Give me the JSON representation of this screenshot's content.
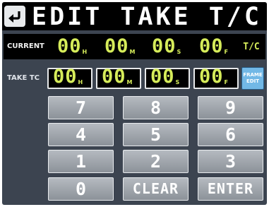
{
  "header": {
    "title": "EDIT TAKE T/C",
    "back_icon": "return-arrow-icon"
  },
  "current": {
    "label": "CURRENT",
    "fields": [
      {
        "value": "00",
        "unit": "H"
      },
      {
        "value": "00",
        "unit": "M"
      },
      {
        "value": "00",
        "unit": "S"
      },
      {
        "value": "00",
        "unit": "F"
      }
    ],
    "tc_label": "T/C"
  },
  "take_tc": {
    "label": "TAKE TC",
    "fields": [
      {
        "value": "00",
        "unit": "H"
      },
      {
        "value": "00",
        "unit": "M"
      },
      {
        "value": "00",
        "unit": "S"
      },
      {
        "value": "00",
        "unit": "F"
      }
    ],
    "frame_edit_label": "FRAME\nEDIT"
  },
  "keypad": {
    "keys": [
      "7",
      "8",
      "9",
      "4",
      "5",
      "6",
      "1",
      "2",
      "3",
      "0",
      "CLEAR",
      "ENTER"
    ]
  },
  "colors": {
    "digit": "#d6ec5a",
    "background": "#3c4450",
    "frame_edit": "#72b8e6"
  }
}
